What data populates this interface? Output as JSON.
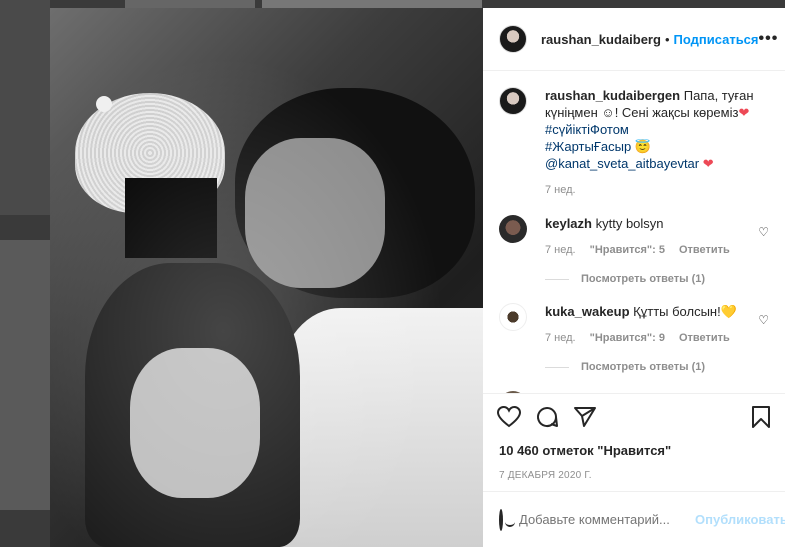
{
  "post": {
    "author": "raushan_kudaiberg",
    "follow_label": "Подписаться",
    "dot": "•",
    "more_label": "•••"
  },
  "caption": {
    "author": "raushan_kudaibergen",
    "text_1": "Папа, туған күніңмен",
    "emoji_1": "☺",
    "text_2": "! Сені жақсы көремiз",
    "heart": "❤",
    "hashtag_1": "#сүйiктiФотом",
    "hashtag_2": "#ЖартыҒасыр",
    "emoji_2": "😇",
    "mention": "@kanat_sveta_aitbayevtar",
    "time": "7 нед."
  },
  "comments": [
    {
      "author": "keylazh",
      "text": "kytty bolsyn",
      "time": "7 нед.",
      "likes": "\"Нравится\": 5",
      "reply": "Ответить",
      "replies": "Посмотреть ответы (1)"
    },
    {
      "author": "kuka_wakeup",
      "text": "Құтты болсын!",
      "emoji": "💛",
      "time": "7 нед.",
      "likes": "\"Нравится\": 9",
      "reply": "Ответить",
      "replies": "Посмотреть ответы (1)"
    }
  ],
  "likes_text": "10 460 отметок \"Нравится\"",
  "date_text": "7 ДЕКАБРЯ 2020 Г.",
  "add_comment": {
    "placeholder": "Добавьте комментарий...",
    "publish_label": "Опубликовать"
  },
  "colors": {
    "accent": "#0095f6",
    "mention": "#00376b",
    "heart": "#ed4956"
  }
}
